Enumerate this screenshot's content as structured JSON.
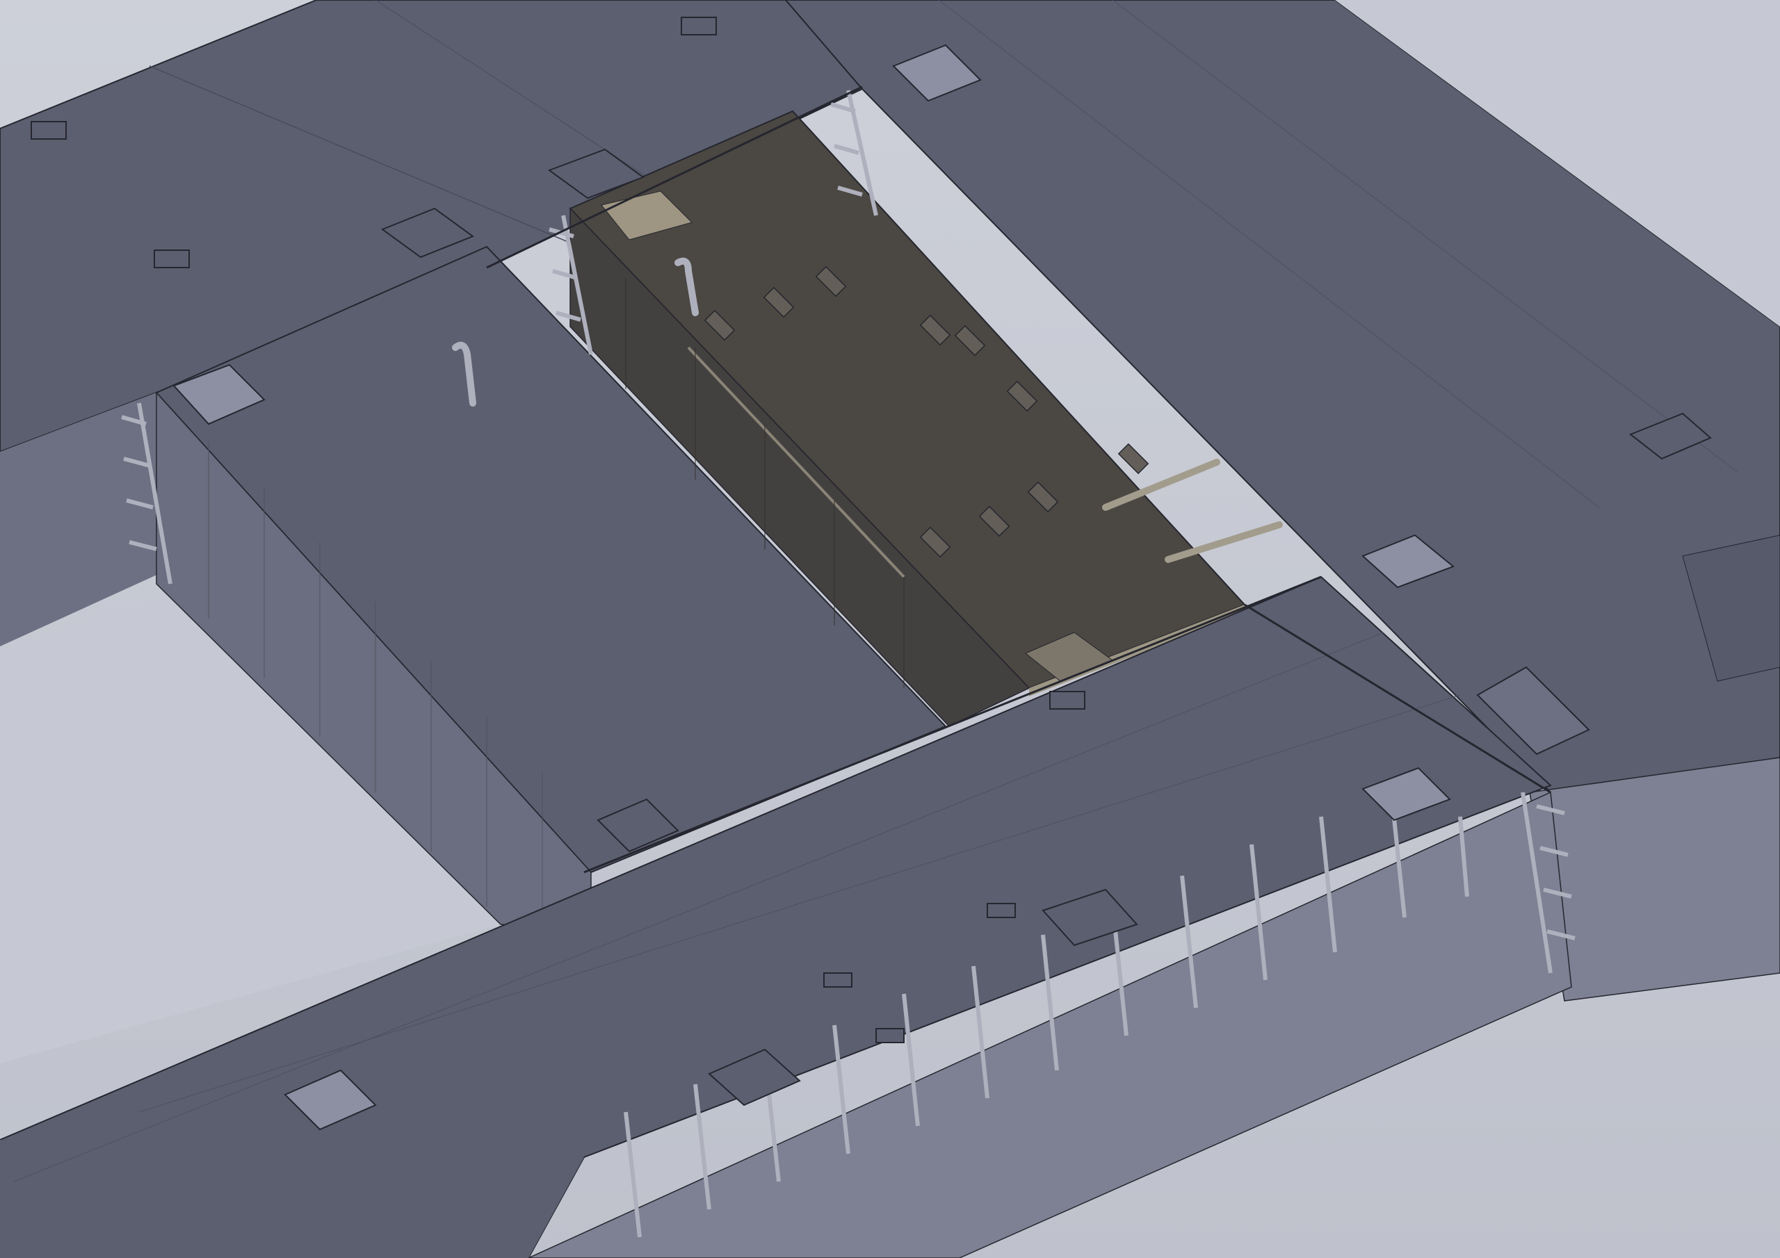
{
  "viewport": {
    "background": "#c6c9d3"
  },
  "model": {
    "deck_color": "#5c5f70",
    "side_color": "#7e8093",
    "highlighted_deck_color": "#4b4742",
    "highlighted_side_color": "#434040",
    "hatch_color": "#8d90a3",
    "edge_color": "#25262f",
    "icons": [
      "hatch-cover-icon",
      "mooring-pipe-icon",
      "ladder-bracket-icon",
      "frame-rib-icon"
    ]
  }
}
